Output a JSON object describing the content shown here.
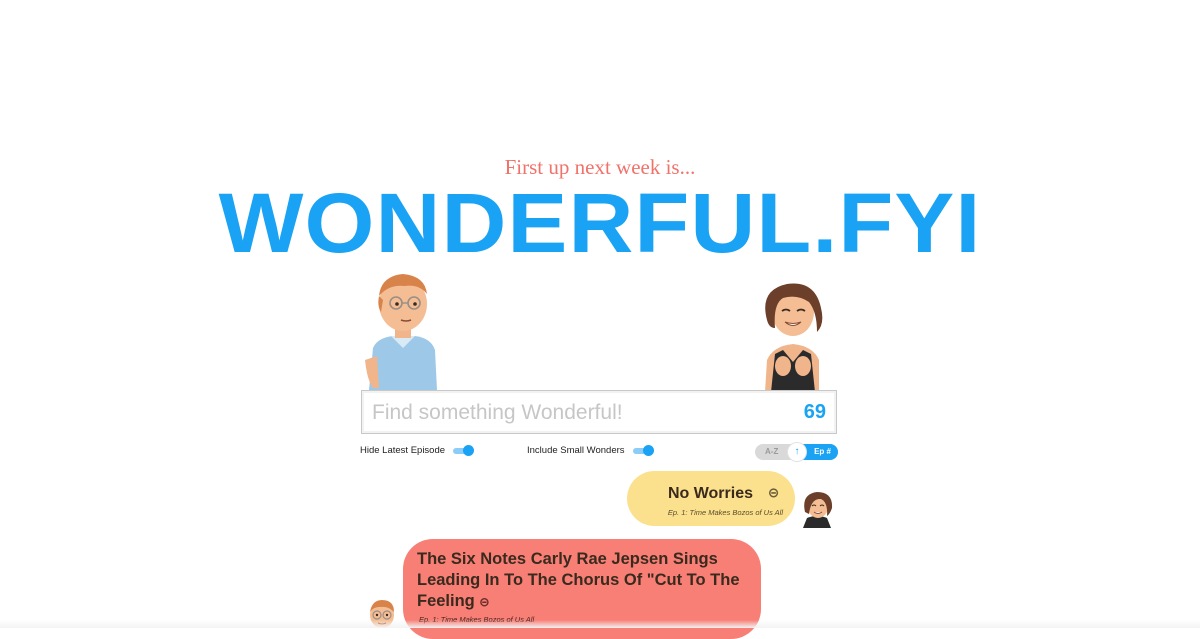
{
  "header": {
    "tagline": "First up next week is...",
    "logo": "WONDERFUL.FYI"
  },
  "search": {
    "placeholder": "Find something Wonderful!",
    "value": "",
    "count": "69"
  },
  "filters": {
    "hide_latest_label": "Hide Latest Episode",
    "hide_latest_on": true,
    "small_wonders_label": "Include Small Wonders",
    "small_wonders_on": true
  },
  "sort": {
    "az_label": "A-Z",
    "arrow": "🡑",
    "ep_label": "Ep #",
    "selected": "Ep #"
  },
  "results": [
    {
      "title": "No Worries",
      "episode": "Ep. 1: Time Makes Bozos of Us All",
      "color": "#fbe18d",
      "host": "woman-host-avatar"
    },
    {
      "title": "The Six Notes Carly Rae Jepsen Sings Leading In To The Chorus Of \"Cut To The Feeling",
      "episode": "Ep. 1: Time Makes Bozos of Us All",
      "color": "#f87f75",
      "host": "man-host-avatar"
    }
  ],
  "colors": {
    "brand_blue": "#1aa3f4",
    "tagline_red": "#f0726a",
    "link_icon": "link-icon"
  }
}
